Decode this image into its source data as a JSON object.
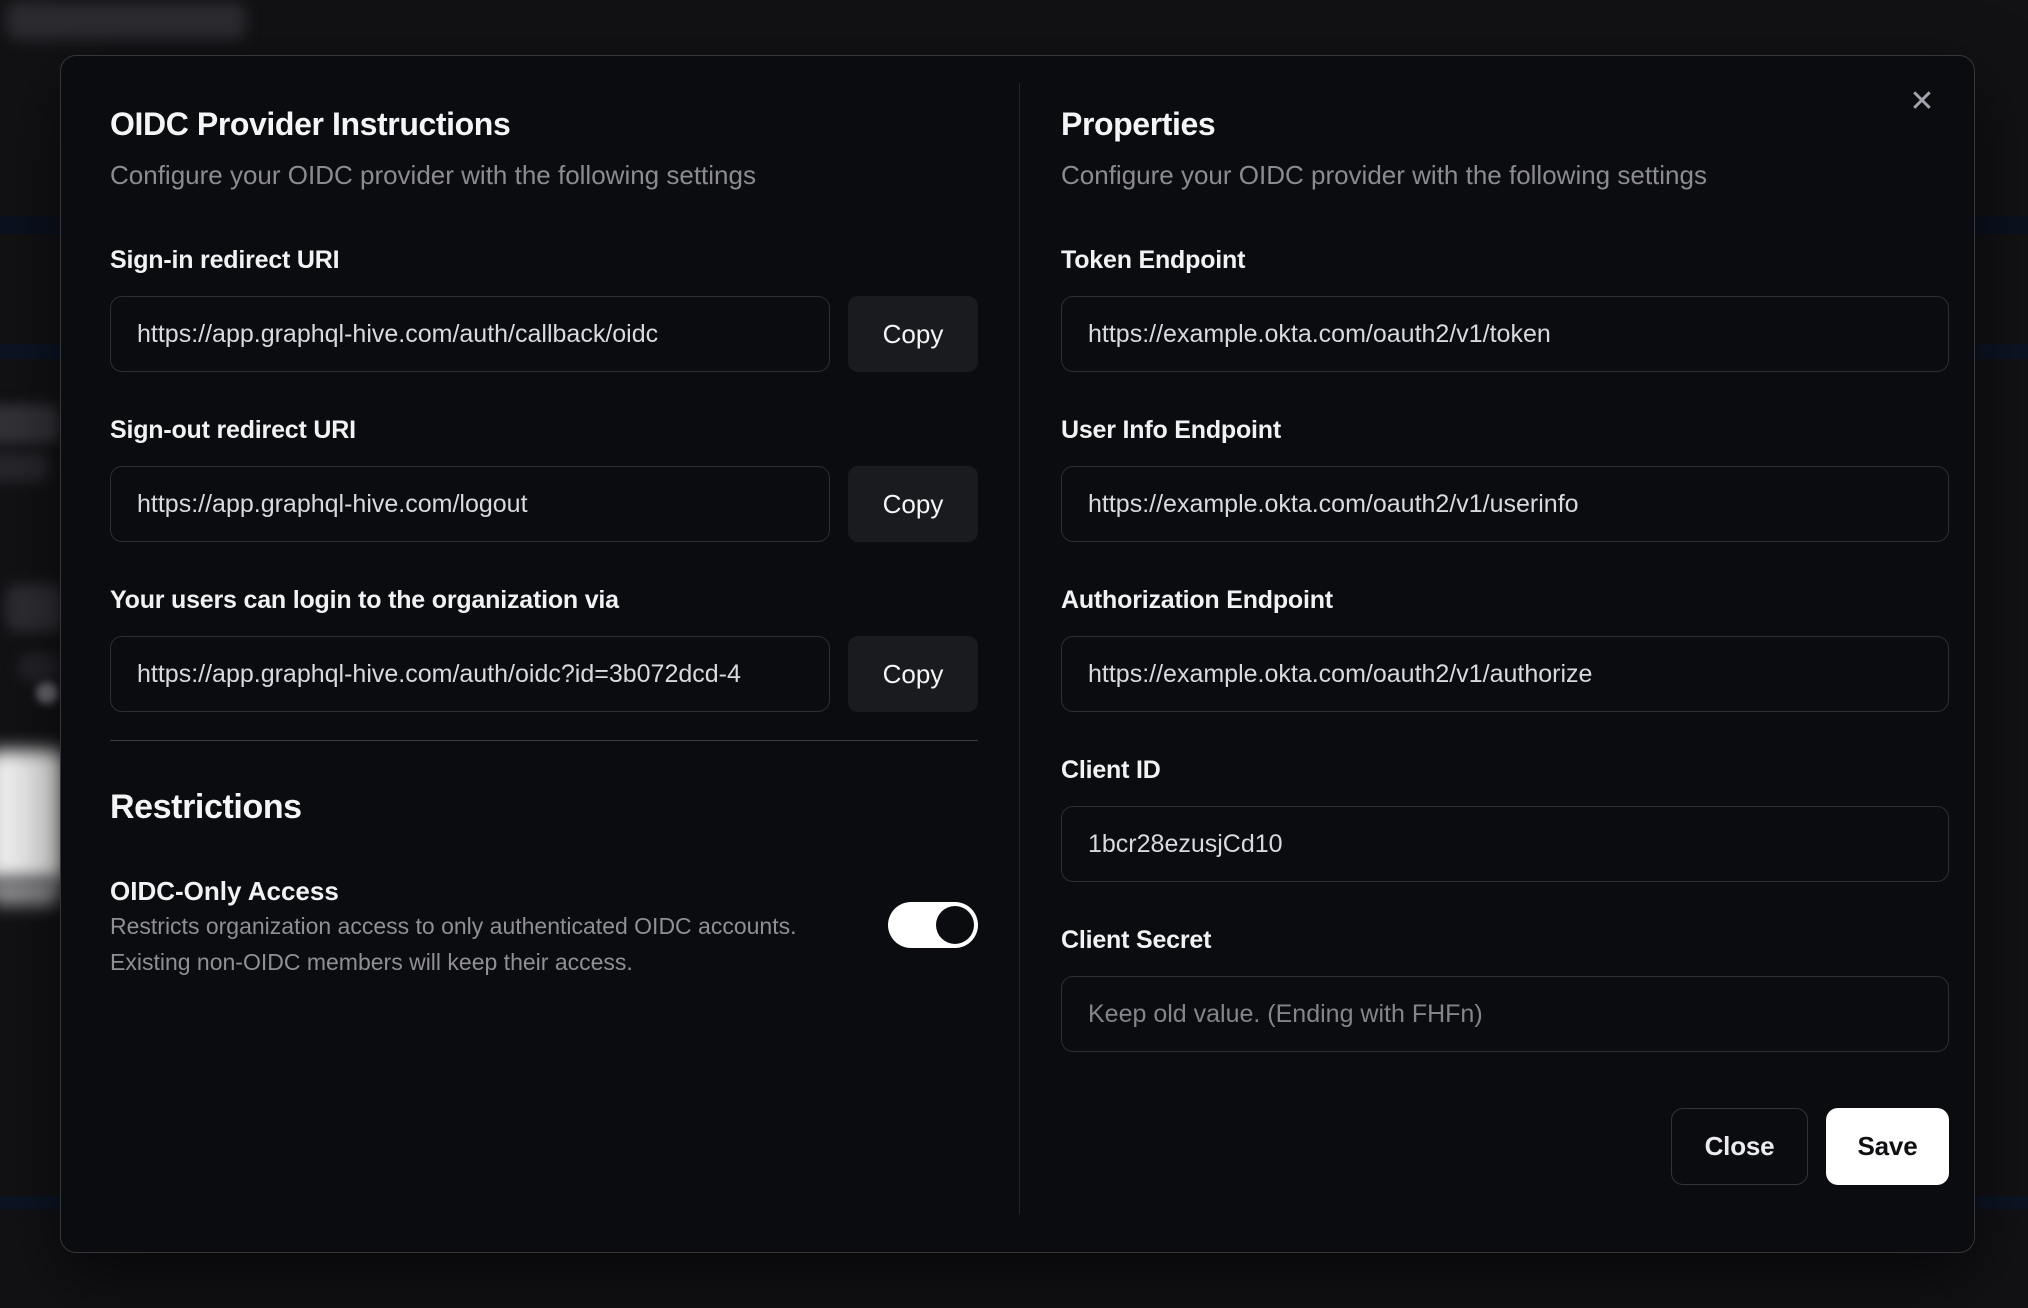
{
  "dialog": {
    "icons": {
      "close": "✕"
    },
    "left": {
      "title": "OIDC Provider Instructions",
      "subtitle": "Configure your OIDC provider with the following settings",
      "fields": [
        {
          "label": "Sign-in redirect URI",
          "value": "https://app.graphql-hive.com/auth/callback/oidc",
          "copy_label": "Copy"
        },
        {
          "label": "Sign-out redirect URI",
          "value": "https://app.graphql-hive.com/logout",
          "copy_label": "Copy"
        },
        {
          "label": "Your users can login to the organization via",
          "value": "https://app.graphql-hive.com/auth/oidc?id=3b072dcd-4",
          "copy_label": "Copy"
        }
      ],
      "restrictions": {
        "title": "Restrictions",
        "toggle_label": "OIDC-Only Access",
        "description_line1": "Restricts organization access to only authenticated OIDC accounts.",
        "description_line2": "Existing non-OIDC members will keep their access.",
        "toggle_state": "on"
      }
    },
    "right": {
      "title": "Properties",
      "subtitle": "Configure your OIDC provider with the following settings",
      "fields": [
        {
          "label": "Token Endpoint",
          "value": "https://example.okta.com/oauth2/v1/token"
        },
        {
          "label": "User Info Endpoint",
          "value": "https://example.okta.com/oauth2/v1/userinfo"
        },
        {
          "label": "Authorization Endpoint",
          "value": "https://example.okta.com/oauth2/v1/authorize"
        },
        {
          "label": "Client ID",
          "value": "1bcr28ezusjCd10"
        },
        {
          "label": "Client Secret",
          "value": "",
          "placeholder": "Keep old value. (Ending with FHFn)"
        }
      ],
      "buttons": {
        "close": "Close",
        "save": "Save"
      }
    },
    "colors": {
      "accent": "#ffffff",
      "toggle_on": "#ffffff",
      "save_button_bg": "#ffffff"
    }
  }
}
